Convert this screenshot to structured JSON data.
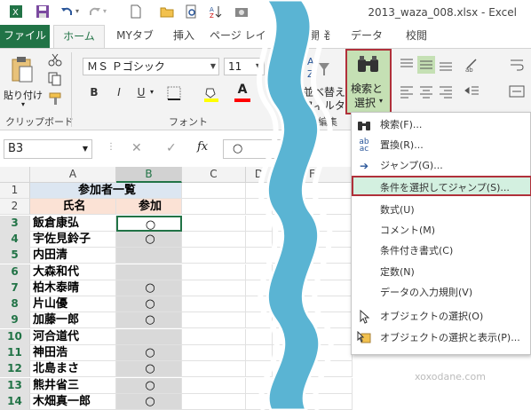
{
  "window": {
    "title": "2013_waza_008.xlsx - Excel"
  },
  "tabs": [
    {
      "label": "ファイル",
      "active": false
    },
    {
      "label": "ホーム",
      "active": true
    },
    {
      "label": "MYタブ",
      "active": false
    },
    {
      "label": "挿入",
      "active": false
    },
    {
      "label": "ページ レイ",
      "active": false
    },
    {
      "label": "開発",
      "active": false
    },
    {
      "label": "データ",
      "active": false
    },
    {
      "label": "校閲",
      "active": false
    }
  ],
  "ribbon": {
    "paste_label": "貼り付け",
    "clipboard_label": "クリップボード",
    "font_label": "フォント",
    "edit_label": "編集",
    "font_name": "ＭＳ Ｐゴシック",
    "font_size": "11",
    "bold": "B",
    "italic": "I",
    "underline": "U",
    "font_color_glyph": "A",
    "sort_label_1": "並べ替えと",
    "sort_label_2": "フィルター",
    "find_label_1": "検索と",
    "find_label_2": "選択",
    "accent": "#217346",
    "highlight_border": "#b0303a"
  },
  "formula_bar": {
    "cell_ref": "B3",
    "fx": "fx",
    "value": "○"
  },
  "sheet": {
    "columns": [
      "A",
      "B",
      "C",
      "D",
      "E",
      "F"
    ],
    "selected_column": "B",
    "title": "参加者一覧",
    "header_name": "氏名",
    "header_join": "参加",
    "rows": [
      {
        "num": "1"
      },
      {
        "num": "2"
      },
      {
        "num": "3",
        "name": "飯倉康弘",
        "join": "○"
      },
      {
        "num": "4",
        "name": "宇佐見鈴子",
        "join": "○"
      },
      {
        "num": "5",
        "name": "内田清",
        "join": ""
      },
      {
        "num": "6",
        "name": "大森和代",
        "join": ""
      },
      {
        "num": "7",
        "name": "柏木泰晴",
        "join": "○"
      },
      {
        "num": "8",
        "name": "片山優",
        "join": "○"
      },
      {
        "num": "9",
        "name": "加藤一郎",
        "join": "○"
      },
      {
        "num": "10",
        "name": "河合道代",
        "join": ""
      },
      {
        "num": "11",
        "name": "神田浩",
        "join": "○"
      },
      {
        "num": "12",
        "name": "北島まさ",
        "join": "○"
      },
      {
        "num": "13",
        "name": "熊井省三",
        "join": "○"
      },
      {
        "num": "14",
        "name": "木畑真一郎",
        "join": "○"
      }
    ]
  },
  "menu": {
    "items": [
      {
        "label": "検索(F)...",
        "icon": "binoculars-icon"
      },
      {
        "label": "置換(R)...",
        "icon": "replace-icon"
      },
      {
        "label": "ジャンプ(G)...",
        "icon": "arrow-right-icon"
      },
      {
        "label": "条件を選択してジャンプ(S)...",
        "icon": "",
        "highlighted": true
      },
      {
        "label": "数式(U)",
        "icon": ""
      },
      {
        "label": "コメント(M)",
        "icon": ""
      },
      {
        "label": "条件付き書式(C)",
        "icon": ""
      },
      {
        "label": "定数(N)",
        "icon": ""
      },
      {
        "label": "データの入力規則(V)",
        "icon": ""
      },
      {
        "label": "オブジェクトの選択(O)",
        "icon": "cursor-icon"
      },
      {
        "label": "オブジェクトの選択と表示(P)...",
        "icon": "selection-pane-icon"
      }
    ]
  },
  "watermark": "xoxodane.com"
}
